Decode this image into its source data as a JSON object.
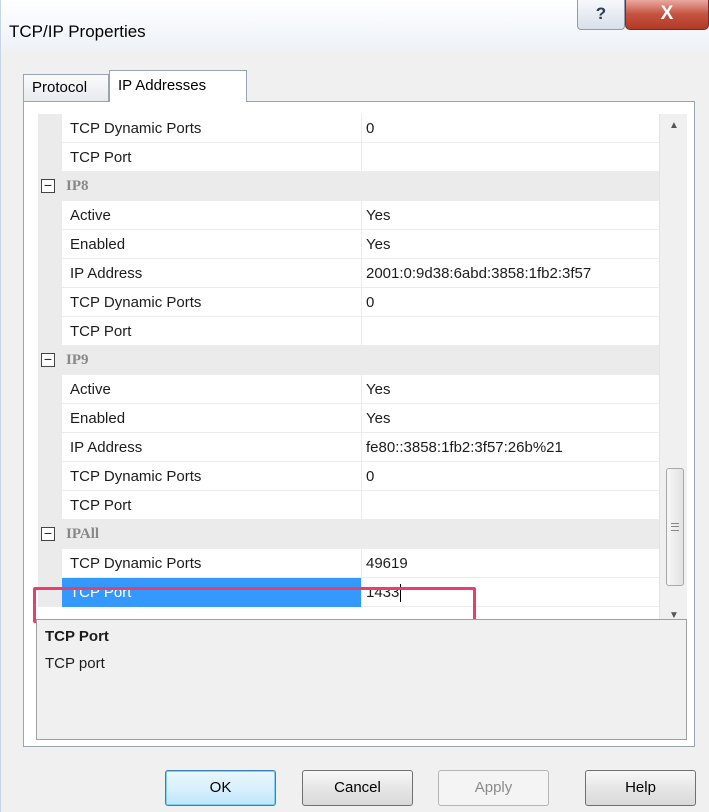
{
  "window": {
    "title": "TCP/IP Properties",
    "help_glyph": "?",
    "close_glyph": "X"
  },
  "tabs": [
    {
      "label": "Protocol",
      "active": false
    },
    {
      "label": "IP Addresses",
      "active": true
    }
  ],
  "grid": {
    "rows": [
      {
        "type": "prop",
        "name": "TCP Dynamic Ports",
        "value": "0"
      },
      {
        "type": "prop",
        "name": "TCP Port",
        "value": ""
      },
      {
        "type": "cat",
        "name": "IP8",
        "toggle": "−"
      },
      {
        "type": "prop",
        "name": "Active",
        "value": "Yes"
      },
      {
        "type": "prop",
        "name": "Enabled",
        "value": "Yes"
      },
      {
        "type": "prop",
        "name": "IP Address",
        "value": "2001:0:9d38:6abd:3858:1fb2:3f57"
      },
      {
        "type": "prop",
        "name": "TCP Dynamic Ports",
        "value": "0"
      },
      {
        "type": "prop",
        "name": "TCP Port",
        "value": ""
      },
      {
        "type": "cat",
        "name": "IP9",
        "toggle": "−"
      },
      {
        "type": "prop",
        "name": "Active",
        "value": "Yes"
      },
      {
        "type": "prop",
        "name": "Enabled",
        "value": "Yes"
      },
      {
        "type": "prop",
        "name": "IP Address",
        "value": "fe80::3858:1fb2:3f57:26b%21"
      },
      {
        "type": "prop",
        "name": "TCP Dynamic Ports",
        "value": "0"
      },
      {
        "type": "prop",
        "name": "TCP Port",
        "value": ""
      },
      {
        "type": "cat",
        "name": "IPAll",
        "toggle": "−"
      },
      {
        "type": "prop",
        "name": "TCP Dynamic Ports",
        "value": "49619"
      },
      {
        "type": "prop",
        "name": "TCP Port",
        "value": "1433",
        "selected": true
      }
    ],
    "scroll_up_icon": "▲",
    "scroll_down_icon": "▼"
  },
  "description": {
    "title": "TCP Port",
    "text": "TCP port"
  },
  "buttons": {
    "ok": "OK",
    "cancel": "Cancel",
    "apply": "Apply",
    "help": "Help"
  },
  "colors": {
    "selection": "#3399ff",
    "highlight_box": "#ea3e6a",
    "close_button": "#c5523f"
  }
}
